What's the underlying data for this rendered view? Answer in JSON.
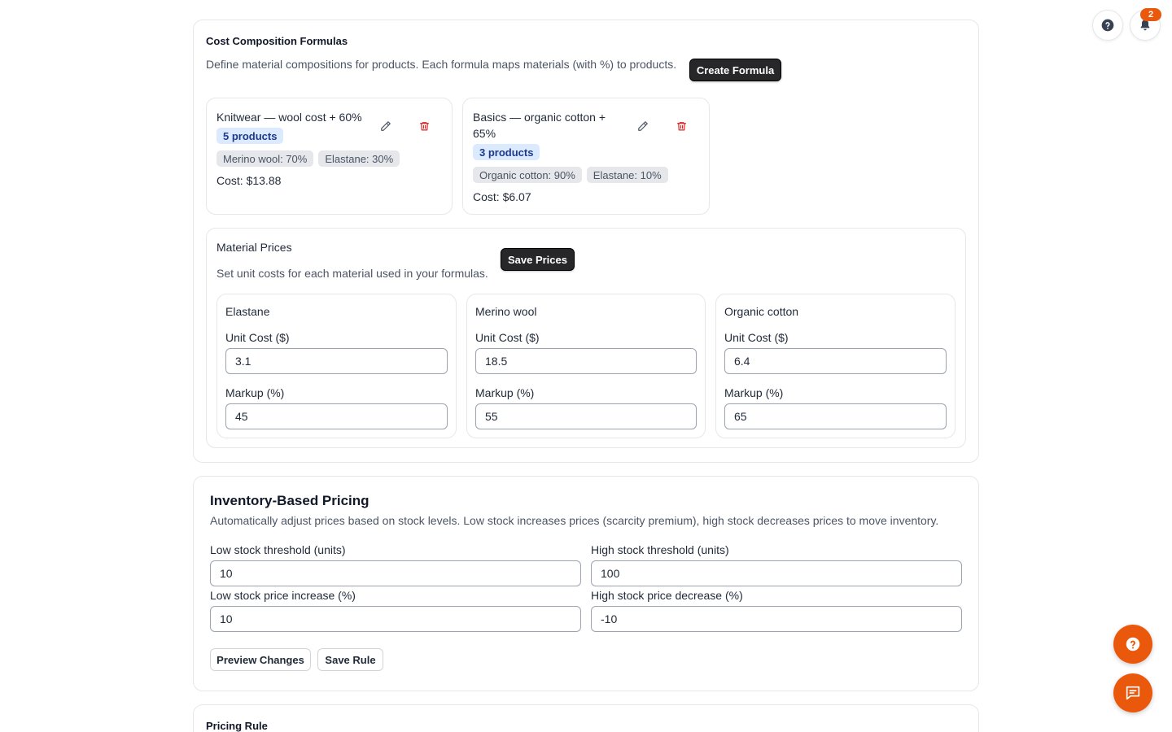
{
  "cost_formulas": {
    "title": "Cost Composition Formulas",
    "description": "Define material compositions for products. Each formula maps materials (with %) to products.",
    "create_label": "Create Formula",
    "formulas": [
      {
        "name": "Knitwear — wool cost + 60%",
        "badge": "5 products",
        "chips": [
          "Merino wool: 70%",
          "Elastane: 30%"
        ],
        "cost": "Cost: $13.88"
      },
      {
        "name_line1": "Basics — organic cotton +",
        "name_line2": "65%",
        "badge": "3 products",
        "chips": [
          "Organic cotton: 90%",
          "Elastane: 10%"
        ],
        "cost": "Cost: $6.07"
      }
    ]
  },
  "material_prices": {
    "title": "Material Prices",
    "description": "Set unit costs for each material used in your formulas.",
    "save_label": "Save Prices",
    "materials": [
      {
        "name": "Elastane",
        "unit_cost_label": "Unit Cost ($)",
        "unit_cost": "3.1",
        "markup_label": "Markup (%)",
        "markup": "45"
      },
      {
        "name": "Merino wool",
        "unit_cost_label": "Unit Cost ($)",
        "unit_cost": "18.5",
        "markup_label": "Markup (%)",
        "markup": "55"
      },
      {
        "name": "Organic cotton",
        "unit_cost_label": "Unit Cost ($)",
        "unit_cost": "6.4",
        "markup_label": "Markup (%)",
        "markup": "65"
      }
    ]
  },
  "inventory": {
    "title": "Inventory-Based Pricing",
    "description": "Automatically adjust prices based on stock levels. Low stock increases prices (scarcity premium), high stock decreases prices to move inventory.",
    "low_threshold_label": "Low stock threshold (units)",
    "low_threshold": "10",
    "high_threshold_label": "High stock threshold (units)",
    "high_threshold": "100",
    "low_increase_label": "Low stock price increase (%)",
    "low_increase": "10",
    "high_decrease_label": "High stock price decrease (%)",
    "high_decrease": "-10",
    "preview_label": "Preview Changes",
    "save_label": "Save Rule"
  },
  "pricing_rule": {
    "title": "Pricing Rule"
  },
  "topbar": {
    "notification_count": "2",
    "help_icon": "question-icon",
    "bell_icon": "bell-icon"
  },
  "fabs": {
    "help_icon": "question-icon",
    "chat_icon": "chat-icon"
  },
  "colors": {
    "accent": "#ea580c",
    "dark_button": "#27272a",
    "badge_bg": "#dbeafe",
    "delete_red": "#dc2626"
  }
}
